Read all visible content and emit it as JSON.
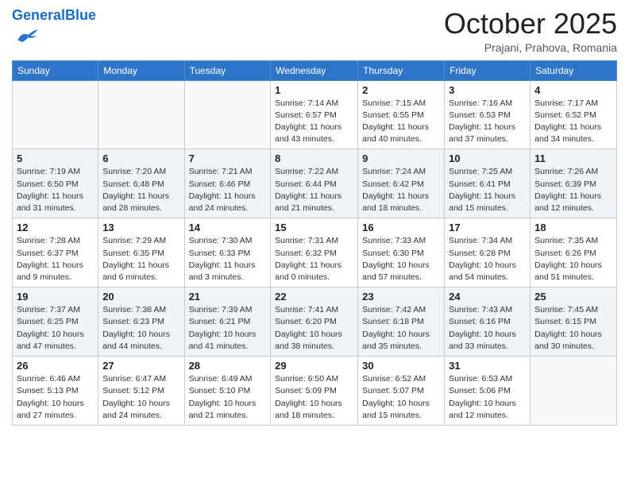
{
  "header": {
    "logo_general": "General",
    "logo_blue": "Blue",
    "month": "October 2025",
    "location": "Prajani, Prahova, Romania"
  },
  "weekdays": [
    "Sunday",
    "Monday",
    "Tuesday",
    "Wednesday",
    "Thursday",
    "Friday",
    "Saturday"
  ],
  "weeks": [
    [
      {
        "day": null
      },
      {
        "day": null
      },
      {
        "day": null
      },
      {
        "day": "1",
        "sunrise": "7:14 AM",
        "sunset": "6:57 PM",
        "daylight": "11 hours and 43 minutes."
      },
      {
        "day": "2",
        "sunrise": "7:15 AM",
        "sunset": "6:55 PM",
        "daylight": "11 hours and 40 minutes."
      },
      {
        "day": "3",
        "sunrise": "7:16 AM",
        "sunset": "6:53 PM",
        "daylight": "11 hours and 37 minutes."
      },
      {
        "day": "4",
        "sunrise": "7:17 AM",
        "sunset": "6:52 PM",
        "daylight": "11 hours and 34 minutes."
      }
    ],
    [
      {
        "day": "5",
        "sunrise": "7:19 AM",
        "sunset": "6:50 PM",
        "daylight": "11 hours and 31 minutes."
      },
      {
        "day": "6",
        "sunrise": "7:20 AM",
        "sunset": "6:48 PM",
        "daylight": "11 hours and 28 minutes."
      },
      {
        "day": "7",
        "sunrise": "7:21 AM",
        "sunset": "6:46 PM",
        "daylight": "11 hours and 24 minutes."
      },
      {
        "day": "8",
        "sunrise": "7:22 AM",
        "sunset": "6:44 PM",
        "daylight": "11 hours and 21 minutes."
      },
      {
        "day": "9",
        "sunrise": "7:24 AM",
        "sunset": "6:42 PM",
        "daylight": "11 hours and 18 minutes."
      },
      {
        "day": "10",
        "sunrise": "7:25 AM",
        "sunset": "6:41 PM",
        "daylight": "11 hours and 15 minutes."
      },
      {
        "day": "11",
        "sunrise": "7:26 AM",
        "sunset": "6:39 PM",
        "daylight": "11 hours and 12 minutes."
      }
    ],
    [
      {
        "day": "12",
        "sunrise": "7:28 AM",
        "sunset": "6:37 PM",
        "daylight": "11 hours and 9 minutes."
      },
      {
        "day": "13",
        "sunrise": "7:29 AM",
        "sunset": "6:35 PM",
        "daylight": "11 hours and 6 minutes."
      },
      {
        "day": "14",
        "sunrise": "7:30 AM",
        "sunset": "6:33 PM",
        "daylight": "11 hours and 3 minutes."
      },
      {
        "day": "15",
        "sunrise": "7:31 AM",
        "sunset": "6:32 PM",
        "daylight": "11 hours and 0 minutes."
      },
      {
        "day": "16",
        "sunrise": "7:33 AM",
        "sunset": "6:30 PM",
        "daylight": "10 hours and 57 minutes."
      },
      {
        "day": "17",
        "sunrise": "7:34 AM",
        "sunset": "6:28 PM",
        "daylight": "10 hours and 54 minutes."
      },
      {
        "day": "18",
        "sunrise": "7:35 AM",
        "sunset": "6:26 PM",
        "daylight": "10 hours and 51 minutes."
      }
    ],
    [
      {
        "day": "19",
        "sunrise": "7:37 AM",
        "sunset": "6:25 PM",
        "daylight": "10 hours and 47 minutes."
      },
      {
        "day": "20",
        "sunrise": "7:38 AM",
        "sunset": "6:23 PM",
        "daylight": "10 hours and 44 minutes."
      },
      {
        "day": "21",
        "sunrise": "7:39 AM",
        "sunset": "6:21 PM",
        "daylight": "10 hours and 41 minutes."
      },
      {
        "day": "22",
        "sunrise": "7:41 AM",
        "sunset": "6:20 PM",
        "daylight": "10 hours and 38 minutes."
      },
      {
        "day": "23",
        "sunrise": "7:42 AM",
        "sunset": "6:18 PM",
        "daylight": "10 hours and 35 minutes."
      },
      {
        "day": "24",
        "sunrise": "7:43 AM",
        "sunset": "6:16 PM",
        "daylight": "10 hours and 33 minutes."
      },
      {
        "day": "25",
        "sunrise": "7:45 AM",
        "sunset": "6:15 PM",
        "daylight": "10 hours and 30 minutes."
      }
    ],
    [
      {
        "day": "26",
        "sunrise": "6:46 AM",
        "sunset": "5:13 PM",
        "daylight": "10 hours and 27 minutes."
      },
      {
        "day": "27",
        "sunrise": "6:47 AM",
        "sunset": "5:12 PM",
        "daylight": "10 hours and 24 minutes."
      },
      {
        "day": "28",
        "sunrise": "6:49 AM",
        "sunset": "5:10 PM",
        "daylight": "10 hours and 21 minutes."
      },
      {
        "day": "29",
        "sunrise": "6:50 AM",
        "sunset": "5:09 PM",
        "daylight": "10 hours and 18 minutes."
      },
      {
        "day": "30",
        "sunrise": "6:52 AM",
        "sunset": "5:07 PM",
        "daylight": "10 hours and 15 minutes."
      },
      {
        "day": "31",
        "sunrise": "6:53 AM",
        "sunset": "5:06 PM",
        "daylight": "10 hours and 12 minutes."
      },
      {
        "day": null
      }
    ]
  ]
}
